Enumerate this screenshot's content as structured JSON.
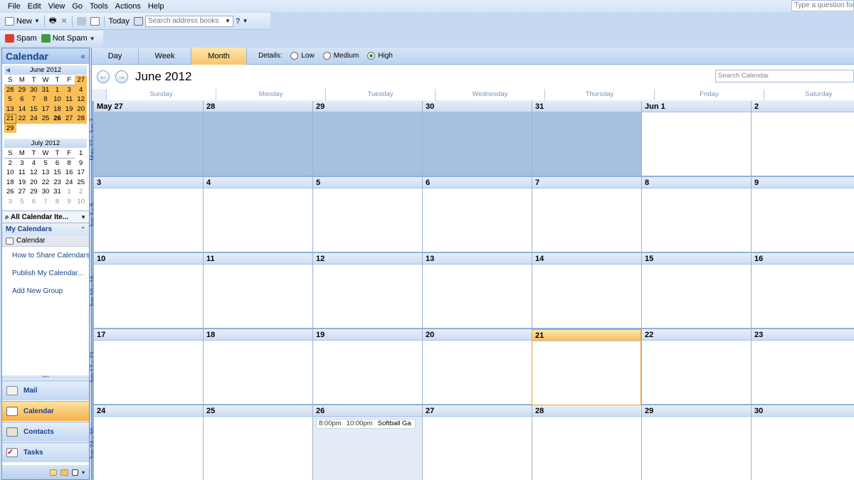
{
  "menu": [
    "File",
    "Edit",
    "View",
    "Go",
    "Tools",
    "Actions",
    "Help"
  ],
  "ask": "Type a question for",
  "toolbar": {
    "new": "New",
    "today": "Today",
    "search_ab": "Search address books",
    "spam": "Spam",
    "not_spam": "Not Spam"
  },
  "nav": {
    "title": "Calendar",
    "mini1": {
      "title": "June 2012",
      "dow": [
        "S",
        "M",
        "T",
        "W",
        "T",
        "F"
      ],
      "rows": [
        [
          "27",
          "28",
          "29",
          "30",
          "31",
          "1"
        ],
        [
          "3",
          "4",
          "5",
          "6",
          "7",
          "8"
        ],
        [
          "10",
          "11",
          "12",
          "13",
          "14",
          "15"
        ],
        [
          "17",
          "18",
          "19",
          "20",
          "21",
          "22"
        ],
        [
          "24",
          "25",
          "26",
          "27",
          "28",
          "29"
        ]
      ]
    },
    "mini2": {
      "title": "July 2012",
      "dow": [
        "S",
        "M",
        "T",
        "W",
        "T",
        "F"
      ],
      "rows": [
        [
          "1",
          "2",
          "3",
          "4",
          "5",
          "6"
        ],
        [
          "8",
          "9",
          "10",
          "11",
          "12",
          "13"
        ],
        [
          "15",
          "16",
          "17",
          "18",
          "19",
          "20"
        ],
        [
          "22",
          "23",
          "24",
          "25",
          "26",
          "27"
        ],
        [
          "29",
          "30",
          "31",
          "1",
          "2",
          "3"
        ],
        [
          "5",
          "6",
          "7",
          "8",
          "9",
          "10"
        ]
      ]
    },
    "all_items": "All Calendar Ite...",
    "my_calendars": "My Calendars",
    "calendar_item": "Calendar",
    "links": [
      "How to Share Calendars",
      "Publish My Calendar...",
      "Add New Group"
    ],
    "buttons": [
      "Mail",
      "Calendar",
      "Contacts",
      "Tasks"
    ]
  },
  "view": {
    "tabs": [
      "Day",
      "Week",
      "Month"
    ],
    "details_label": "Details:",
    "levels": [
      "Low",
      "Medium",
      "High"
    ],
    "title": "June 2012",
    "search": "Search Calendar"
  },
  "dow": [
    "Sunday",
    "Monday",
    "Tuesday",
    "Wednesday",
    "Thursday",
    "Friday",
    "Saturday"
  ],
  "weeks": [
    {
      "label": "May 27 - Jun 2",
      "days": [
        "May 27",
        "28",
        "29",
        "30",
        "31",
        "Jun 1",
        "2"
      ]
    },
    {
      "label": "Jun 3 - 9",
      "days": [
        "3",
        "4",
        "5",
        "6",
        "7",
        "8",
        "9"
      ]
    },
    {
      "label": "Jun 10 - 16",
      "days": [
        "10",
        "11",
        "12",
        "13",
        "14",
        "15",
        "16"
      ]
    },
    {
      "label": "Jun 17 - 23",
      "days": [
        "17",
        "18",
        "19",
        "20",
        "21",
        "22",
        "23"
      ]
    },
    {
      "label": "Jun 24 - 30",
      "days": [
        "24",
        "25",
        "26",
        "27",
        "28",
        "29",
        "30"
      ]
    }
  ],
  "appointment": {
    "start": "8:00pm",
    "end": "10:00pm",
    "subject": "Softball Ga"
  }
}
